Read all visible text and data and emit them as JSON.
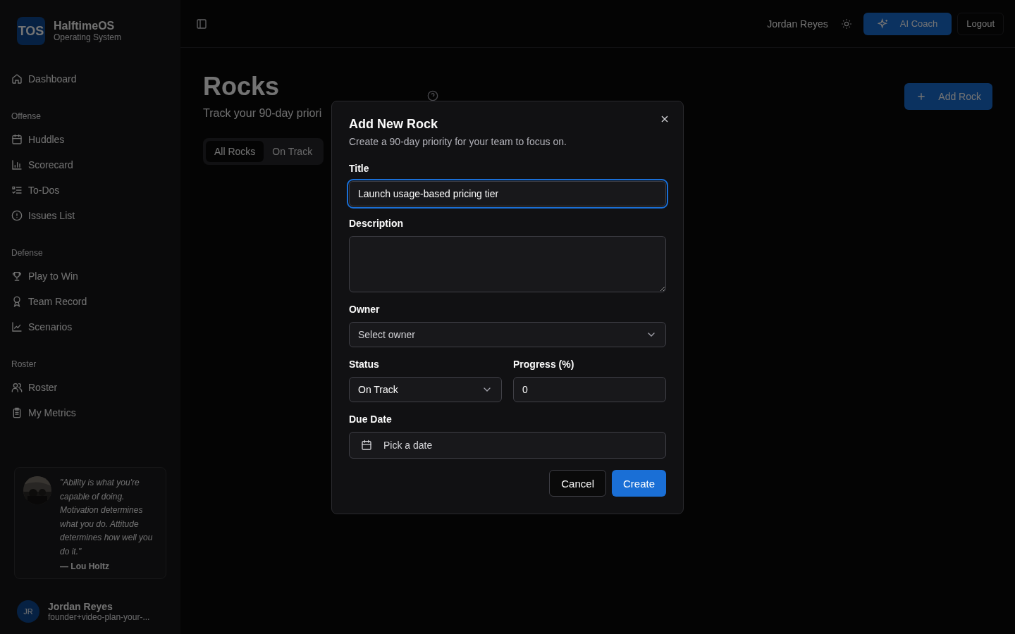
{
  "brand": {
    "logo": "TOS",
    "name": "HalftimeOS",
    "subtitle": "Operating System"
  },
  "nav": [
    {
      "items": [
        {
          "label": "Dashboard"
        }
      ]
    },
    {
      "heading": "Offense",
      "items": [
        {
          "label": "Huddles"
        },
        {
          "label": "Scorecard"
        },
        {
          "label": "To-Dos"
        },
        {
          "label": "Issues List"
        }
      ]
    },
    {
      "heading": "Defense",
      "items": [
        {
          "label": "Play to Win"
        },
        {
          "label": "Team Record"
        },
        {
          "label": "Scenarios"
        }
      ]
    },
    {
      "heading": "Roster",
      "items": [
        {
          "label": "Roster"
        },
        {
          "label": "My Metrics"
        }
      ]
    }
  ],
  "quote": {
    "text": "\"Ability is what you're capable of doing. Motivation determines what you do. Attitude determines how well you do it.\"",
    "author": "— Lou Holtz"
  },
  "user": {
    "initials": "JR",
    "name": "Jordan Reyes",
    "email": "founder+video-plan-your-..."
  },
  "topbar": {
    "user_name": "Jordan Reyes",
    "ai_button": "AI Coach",
    "logout": "Logout"
  },
  "page": {
    "title": "Rocks",
    "subtitle": "Track your 90-day priori",
    "add_button": "Add Rock",
    "filters": [
      {
        "label": "All Rocks",
        "selected": true
      },
      {
        "label": "On Track",
        "selected": false
      }
    ]
  },
  "dialog": {
    "title": "Add New Rock",
    "description": "Create a 90-day priority for your team to focus on.",
    "rows": [
      [
        {
          "kind": "text",
          "label": "Title",
          "value": "Launch usage-based pricing tier",
          "focused": true
        }
      ],
      [
        {
          "kind": "textarea",
          "label": "Description"
        }
      ],
      [
        {
          "kind": "select",
          "label": "Owner",
          "placeholder": "Select owner"
        }
      ],
      [
        {
          "kind": "select",
          "label": "Status",
          "value": "On Track"
        },
        {
          "kind": "number",
          "label": "Progress (%)",
          "value": "0"
        }
      ],
      [
        {
          "kind": "date",
          "label": "Due Date",
          "placeholder": "Pick a date"
        }
      ]
    ],
    "cancel": "Cancel",
    "create": "Create"
  }
}
